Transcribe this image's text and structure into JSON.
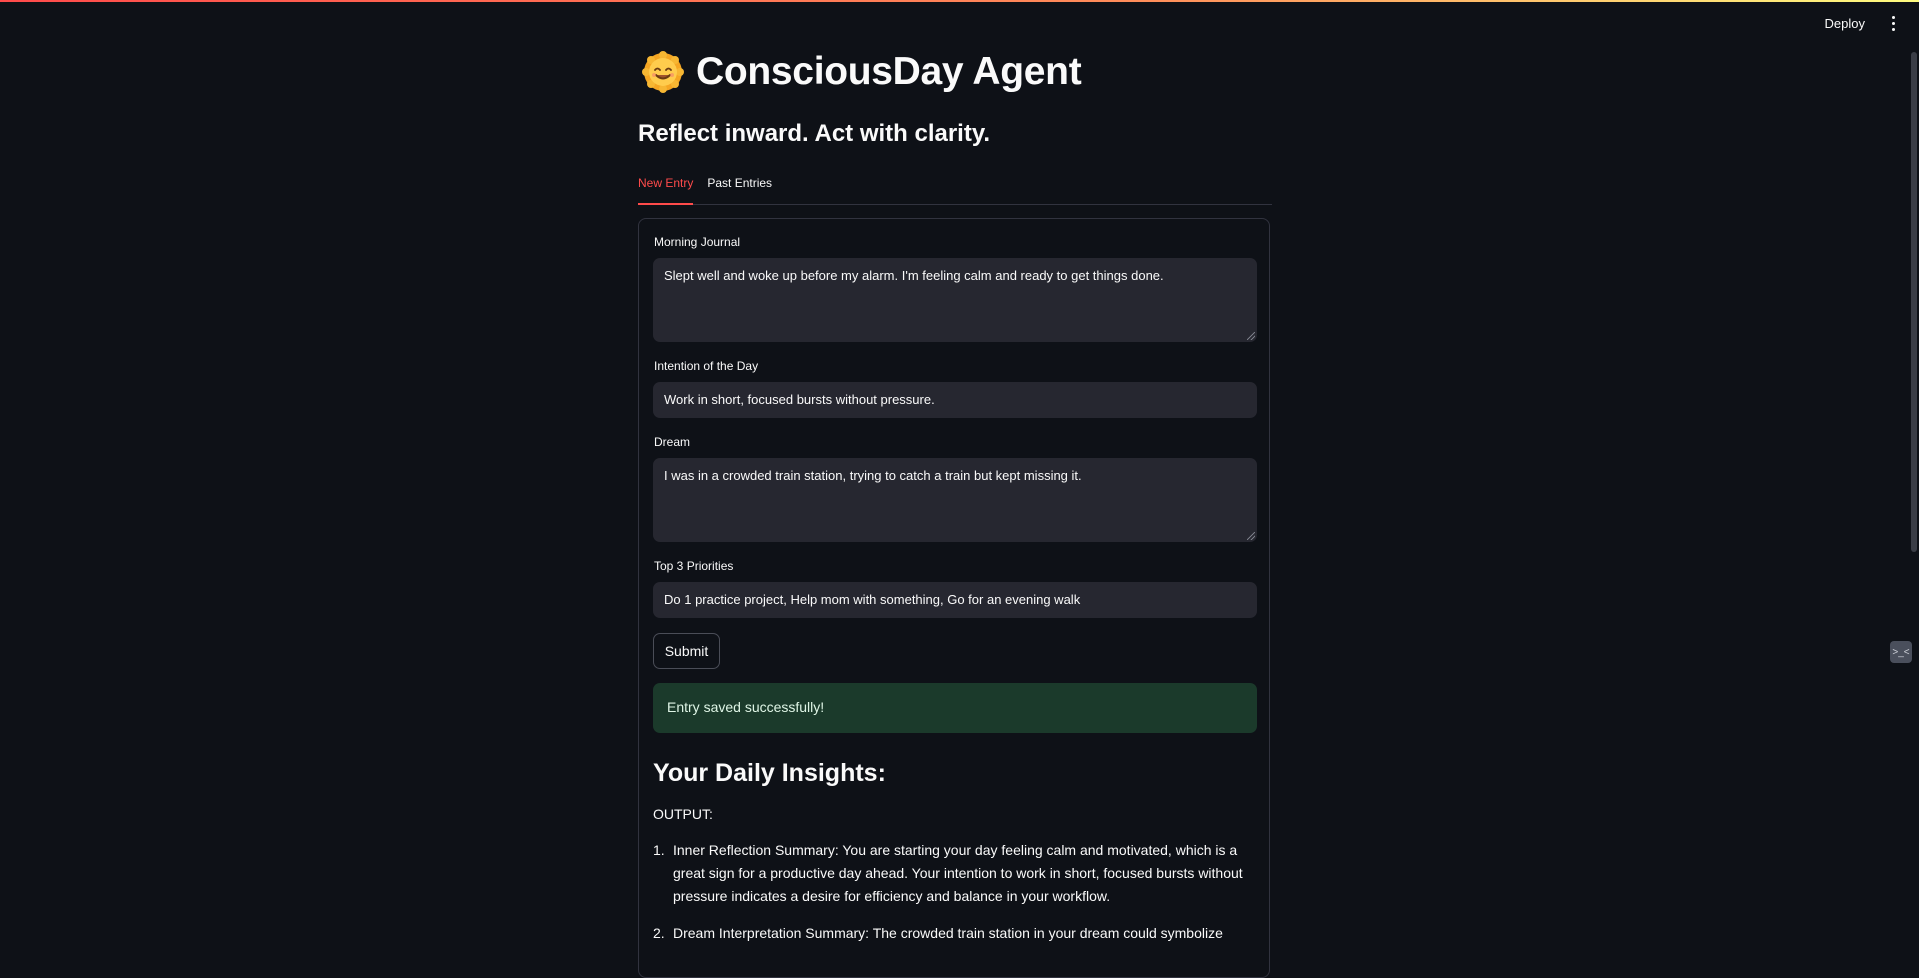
{
  "header": {
    "deploy_label": "Deploy"
  },
  "app": {
    "title": "ConsciousDay Agent",
    "title_icon": "smiling-sun-icon",
    "subtitle": "Reflect inward. Act with clarity."
  },
  "tabs": [
    {
      "label": "New Entry",
      "active": true
    },
    {
      "label": "Past Entries",
      "active": false
    }
  ],
  "form": {
    "journal": {
      "label": "Morning Journal",
      "value": "Slept well and woke up before my alarm. I'm feeling calm and ready to get things done."
    },
    "intention": {
      "label": "Intention of the Day",
      "value": "Work in short, focused bursts without pressure."
    },
    "dream": {
      "label": "Dream",
      "value": "I was in a crowded train station, trying to catch a train but kept missing it."
    },
    "priorities": {
      "label": "Top 3 Priorities",
      "value": "Do 1 practice project, Help mom with something, Go for an evening walk"
    },
    "submit_label": "Submit"
  },
  "status": {
    "success_message": "Entry saved successfully!"
  },
  "insights": {
    "heading": "Your Daily Insights:",
    "output_label": "OUTPUT:",
    "items": [
      {
        "number": "1.",
        "text": "Inner Reflection Summary: You are starting your day feeling calm and motivated, which is a great sign for a productive day ahead. Your intention to work in short, focused bursts without pressure indicates a desire for efficiency and balance in your workflow."
      },
      {
        "number": "2.",
        "text": "Dream Interpretation Summary: The crowded train station in your dream could symbolize"
      }
    ]
  },
  "colors": {
    "background": "#0e1117",
    "accent": "#ff4b4b",
    "input_bg": "#262730",
    "success_bg": "#1b3a2b"
  }
}
